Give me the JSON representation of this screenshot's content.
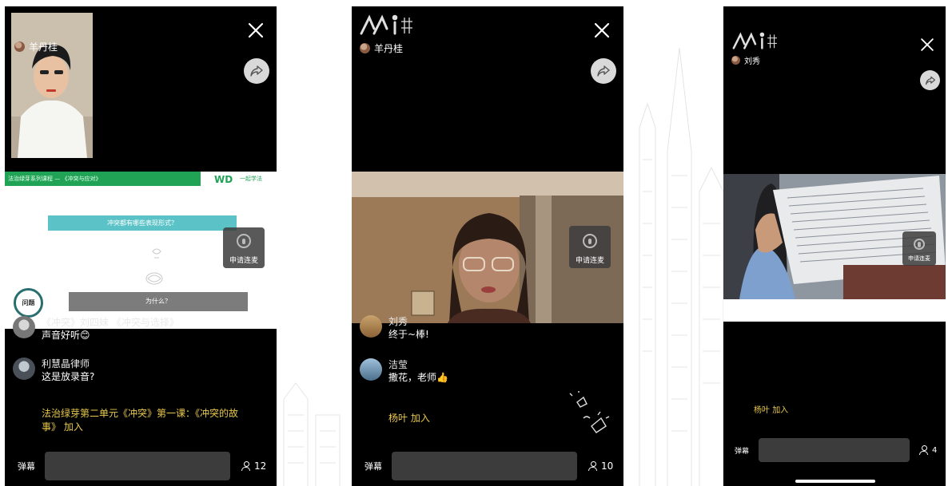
{
  "phones": [
    {
      "host": "羊丹桂",
      "slide": {
        "header": "法治绿芽系列课程 — 《冲突与应对》",
        "logo_wd": "WD",
        "logo_right": "一起学法",
        "question": "冲突都有哪些表现形式？",
        "why_button": "为什么？",
        "badge": "问题"
      },
      "apply_label": "申请连麦",
      "comments": [
        {
          "name": "《冲突》刘四妹 《冲突与选择》",
          "text": "声音好听😊"
        },
        {
          "name": "利慧晶律师",
          "text": "这是放录音?"
        }
      ],
      "join": {
        "name": "法治绿芽第二单元《冲突》第一课：《冲突的故事》",
        "action": "加入"
      },
      "danmu_label": "弹幕",
      "danmu_placeholder": "",
      "viewers": "12"
    },
    {
      "host": "羊丹桂",
      "apply_label": "申请连麦",
      "comments": [
        {
          "name": "刘秀",
          "text": "终于~棒!"
        },
        {
          "name": "洁莹",
          "text": "撒花，老师👍"
        }
      ],
      "join": {
        "name": "杨叶",
        "action": "加入"
      },
      "danmu_label": "弹幕",
      "danmu_placeholder": "",
      "viewers": "10"
    },
    {
      "host": "刘秀",
      "apply_label": "申请连麦",
      "join": {
        "name": "杨叶",
        "action": "加入"
      },
      "danmu_label": "弹幕",
      "danmu_placeholder": "",
      "viewers": "4"
    }
  ],
  "icons": {
    "close": "close-icon",
    "share": "share-icon",
    "viewer": "person-icon",
    "mic": "mic-icon"
  },
  "colors": {
    "join_text": "#e8c84a",
    "slide_header": "#21a356",
    "question_bar": "#5bc3c7"
  }
}
